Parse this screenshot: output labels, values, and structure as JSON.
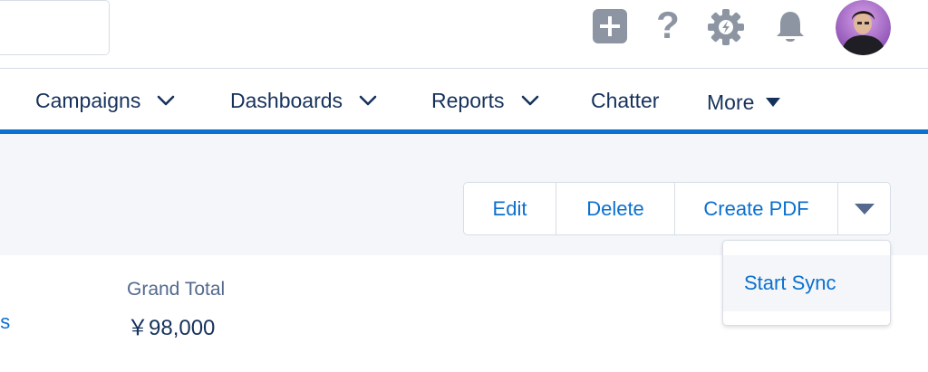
{
  "header": {
    "icons": [
      "add-icon",
      "help-icon",
      "gear-icon",
      "bell-icon"
    ],
    "help_glyph": "?"
  },
  "nav": {
    "items": [
      {
        "label": "Campaigns"
      },
      {
        "label": "Dashboards"
      },
      {
        "label": "Reports"
      },
      {
        "label": "Chatter"
      },
      {
        "label": "More"
      }
    ],
    "accent_color": "#0b72d4"
  },
  "actions": {
    "edit": "Edit",
    "delete": "Delete",
    "create_pdf": "Create PDF"
  },
  "dropdown": {
    "items": [
      "Start Sync"
    ]
  },
  "details": {
    "partial_link": "ns",
    "grand_total_label": "Grand Total",
    "grand_total_value": "￥98,000"
  },
  "colors": {
    "link": "#0b70cf",
    "text_dark": "#16325c",
    "label": "#54698d",
    "icon_gray": "#8c95a1"
  }
}
